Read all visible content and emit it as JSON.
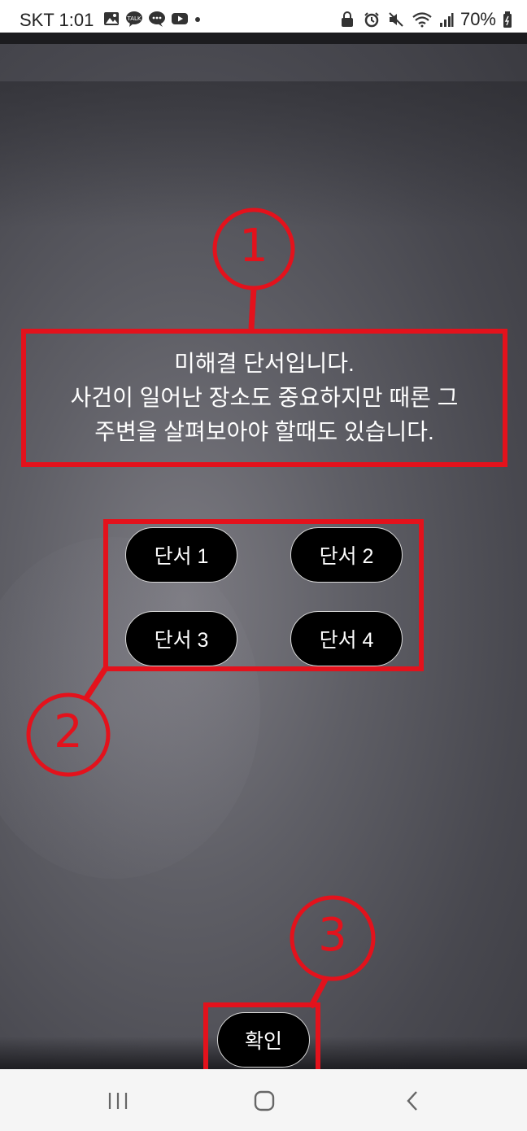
{
  "status_bar": {
    "carrier_time": "SKT 1:01",
    "battery": "70%",
    "left_icons": [
      "gallery-icon",
      "kakaotalk-icon",
      "message-icon",
      "youtube-icon",
      "dot-icon"
    ],
    "right_icons": [
      "lock-icon",
      "alarm-icon",
      "mute-icon",
      "wifi-icon",
      "signal-icon",
      "battery-icon"
    ]
  },
  "dialog": {
    "lines": [
      "미해결 단서입니다.",
      "사건이 일어난 장소도 중요하지만 때론 그",
      "주변을 살펴보아야 할때도 있습니다."
    ]
  },
  "clues": [
    "단서 1",
    "단서 2",
    "단서 3",
    "단서 4"
  ],
  "confirm_label": "확인",
  "annotations": [
    "1",
    "2",
    "3"
  ],
  "colors": {
    "annotation_red": "#e3121c",
    "button_bg": "#000000"
  },
  "nav": {
    "recents": "recents-icon",
    "home": "home-icon",
    "back": "back-icon"
  }
}
